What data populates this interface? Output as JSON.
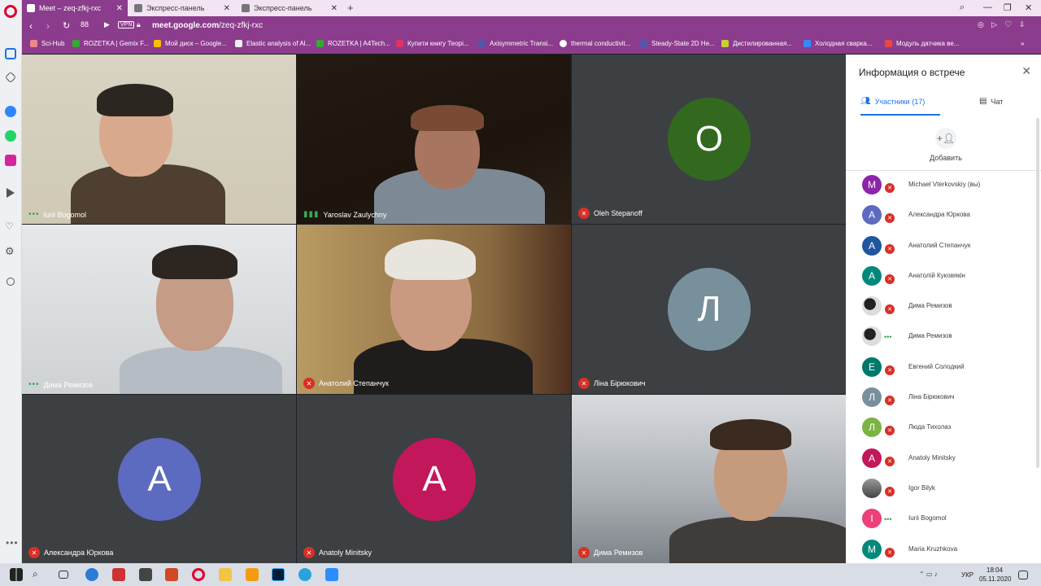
{
  "tabs": [
    {
      "label": "Meet – zeq-zfkj-rxc",
      "active": true
    },
    {
      "label": "Экспресс-панель",
      "active": false
    },
    {
      "label": "Экспресс-панель",
      "active": false
    }
  ],
  "address": {
    "vpn": "VPN",
    "url_host": "meet.google.com",
    "url_path": "/zeq-zfkj-rxc"
  },
  "bookmarks": [
    "Sci-Hub",
    "ROZETKA | Gemix F...",
    "Мой диск – Google...",
    "Elastic analysis of Al...",
    "ROZETKA | A4Tech...",
    "Купити книгу Теорі...",
    "Axisymmetric Transi...",
    "thermal conductivit...",
    "Steady-State 2D He...",
    "Дистилированная...",
    "Холодная сварка...",
    "Модуль датчика ве..."
  ],
  "tiles": [
    {
      "name": "Iurii Bogomol",
      "status": "dots"
    },
    {
      "name": "Yaroslav Zaulychny",
      "status": "speaking"
    },
    {
      "name": "Oleh Stepanoff",
      "status": "muted",
      "letter": "O",
      "color": "#33691e"
    },
    {
      "name": "Дима Ремизов",
      "status": "dots"
    },
    {
      "name": "Анатолий Степанчук",
      "status": "muted"
    },
    {
      "name": "Ліна Бірюкович",
      "status": "muted",
      "letter": "Л",
      "color": "#78909c"
    },
    {
      "name": "Александра Юркова",
      "status": "muted",
      "letter": "А",
      "color": "#5c6bc0"
    },
    {
      "name": "Anatoly Minitsky",
      "status": "muted",
      "letter": "А",
      "color": "#c2185b"
    },
    {
      "name": "Дима Ремизов",
      "status": "muted"
    }
  ],
  "panel": {
    "title": "Информация о встрече",
    "tab_people": "Участники (17)",
    "tab_chat": "Чат",
    "add_label": "Добавить",
    "people": [
      {
        "name": "Michael Vterkovskiy (вы)",
        "letter": "M",
        "color": "#8e24aa",
        "status": "muted"
      },
      {
        "name": "Александра Юркова",
        "letter": "А",
        "color": "#5c6bc0",
        "status": "muted"
      },
      {
        "name": "Анатолий Степанчук",
        "letter": "А",
        "color": "#1e56a0",
        "status": "muted"
      },
      {
        "name": "Анатолій Куковякін",
        "letter": "А",
        "color": "#00897b",
        "status": "muted"
      },
      {
        "name": "Дима Ремизов",
        "letter": "",
        "color": "#333333",
        "status": "muted"
      },
      {
        "name": "Дима Ремизов",
        "letter": "",
        "color": "#333333",
        "status": "dots"
      },
      {
        "name": "Евгений Солодкий",
        "letter": "Е",
        "color": "#00796b",
        "status": "muted"
      },
      {
        "name": "Ліна Бірюкович",
        "letter": "Л",
        "color": "#78909c",
        "status": "muted"
      },
      {
        "name": "Люда Тихолаз",
        "letter": "Л",
        "color": "#7cb342",
        "status": "muted"
      },
      {
        "name": "Anatoly Minitsky",
        "letter": "A",
        "color": "#c2185b",
        "status": "muted"
      },
      {
        "name": "Igor Bilyk",
        "letter": "",
        "color": "#555555",
        "status": "muted"
      },
      {
        "name": "Iurii Bogomol",
        "letter": "I",
        "color": "#ec407a",
        "status": "dots"
      },
      {
        "name": "Maria Kruzhkova",
        "letter": "M",
        "color": "#00897b",
        "status": "muted"
      }
    ]
  },
  "taskbar": {
    "lang": "УКР",
    "time": "18:04",
    "date": "05.11.2020"
  }
}
